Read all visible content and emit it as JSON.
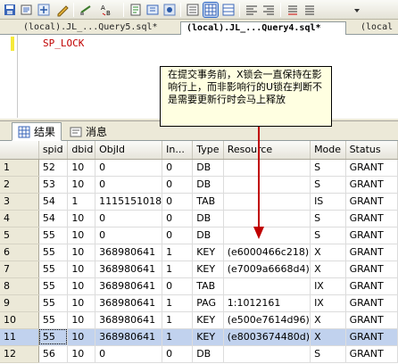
{
  "toolbar": {
    "icons": [
      "save-icon",
      "undo-icon",
      "find-icon",
      "comment-icon",
      "spellcheck-icon",
      "results-to-grid-icon",
      "results-to-text-icon",
      "results-to-file-icon",
      "indent-icon",
      "outdent-icon",
      "uncomment-icon"
    ]
  },
  "doc_tabs": [
    {
      "label": "(local).JL_...Query5.sql*"
    },
    {
      "label": "(local).JL_...Query4.sql*"
    },
    {
      "label": "(local"
    }
  ],
  "editor": {
    "code": "SP_LOCK"
  },
  "callout": {
    "text": "在提交事务前，X锁会一直保持在影响行上，而非影响行的U锁在判断不是需要更新行时会马上释放"
  },
  "result_tabs": [
    {
      "label": "结果",
      "icon": "grid-icon"
    },
    {
      "label": "消息",
      "icon": "messages-icon"
    }
  ],
  "grid": {
    "columns": [
      "spid",
      "dbid",
      "ObjId",
      "In...",
      "Type",
      "Resource",
      "Mode",
      "Status"
    ],
    "rows": [
      [
        "1",
        "52",
        "10",
        "0",
        "0",
        "DB",
        "",
        "S",
        "GRANT"
      ],
      [
        "2",
        "53",
        "10",
        "0",
        "0",
        "DB",
        "",
        "S",
        "GRANT"
      ],
      [
        "3",
        "54",
        "1",
        "1115151018",
        "0",
        "TAB",
        "",
        "IS",
        "GRANT"
      ],
      [
        "4",
        "54",
        "10",
        "0",
        "0",
        "DB",
        "",
        "S",
        "GRANT"
      ],
      [
        "5",
        "55",
        "10",
        "0",
        "0",
        "DB",
        "",
        "S",
        "GRANT"
      ],
      [
        "6",
        "55",
        "10",
        "368980641",
        "1",
        "KEY",
        "(e6000466c218)",
        "X",
        "GRANT"
      ],
      [
        "7",
        "55",
        "10",
        "368980641",
        "1",
        "KEY",
        "(e7009a6668d4)",
        "X",
        "GRANT"
      ],
      [
        "8",
        "55",
        "10",
        "368980641",
        "0",
        "TAB",
        "",
        "IX",
        "GRANT"
      ],
      [
        "9",
        "55",
        "10",
        "368980641",
        "1",
        "PAG",
        "1:1012161",
        "IX",
        "GRANT"
      ],
      [
        "10",
        "55",
        "10",
        "368980641",
        "1",
        "KEY",
        "(e500e7614d96)",
        "X",
        "GRANT"
      ],
      [
        "11",
        "55",
        "10",
        "368980641",
        "1",
        "KEY",
        "(e8003674480d)",
        "X",
        "GRANT"
      ],
      [
        "12",
        "56",
        "10",
        "0",
        "0",
        "DB",
        "",
        "S",
        "GRANT"
      ]
    ],
    "selected_row": 11
  }
}
